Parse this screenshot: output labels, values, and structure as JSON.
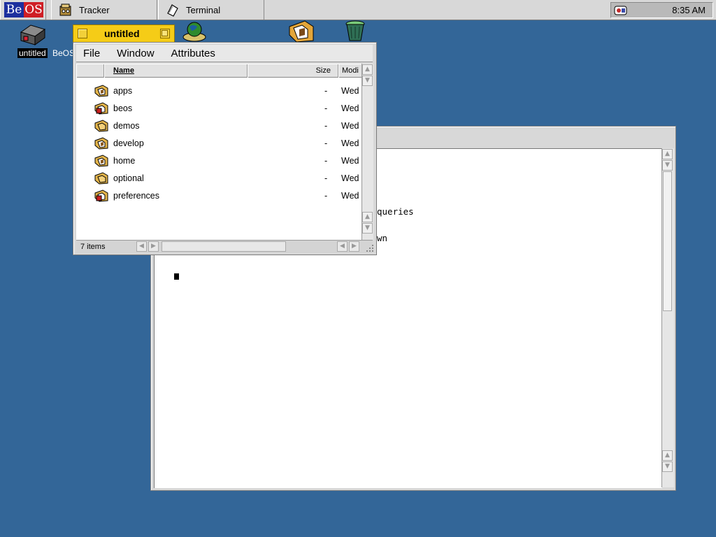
{
  "deskbar": {
    "logo_be": "Be",
    "logo_os": "OS",
    "tasks": [
      {
        "label": "Tracker",
        "icon": "tracker-icon"
      },
      {
        "label": "Terminal",
        "icon": "terminal-icon"
      }
    ],
    "clock": "8:35 AM"
  },
  "desktop": {
    "icons": [
      {
        "label": "untitled",
        "icon": "disk-icon",
        "selected": true
      },
      {
        "label": "BeOS",
        "icon": "beos-disk-icon"
      }
    ]
  },
  "tracker_window": {
    "title": "untitled",
    "menus": [
      "File",
      "Window",
      "Attributes"
    ],
    "columns": {
      "name": "Name",
      "size": "Size",
      "modified": "Modi"
    },
    "items": [
      {
        "name": "apps",
        "size": "-",
        "modified": "Wed",
        "icon": "query-folder-icon"
      },
      {
        "name": "beos",
        "size": "-",
        "modified": "Wed",
        "icon": "system-folder-icon"
      },
      {
        "name": "demos",
        "size": "-",
        "modified": "Wed",
        "icon": "folder-icon"
      },
      {
        "name": "develop",
        "size": "-",
        "modified": "Wed",
        "icon": "query-folder-icon"
      },
      {
        "name": "home",
        "size": "-",
        "modified": "Wed",
        "icon": "query-folder-icon"
      },
      {
        "name": "optional",
        "size": "-",
        "modified": "Wed",
        "icon": "folder-icon"
      },
      {
        "name": "preferences",
        "size": "-",
        "modified": "Wed",
        "icon": "system-folder-icon"
      }
    ],
    "item_count": "7 items"
  },
  "terminal_window": {
    "line1": "queries",
    "line2": "wn"
  },
  "colors": {
    "desktop": "#336698",
    "active_tab": "#f5cc17",
    "window_gray": "#d8d8d8"
  }
}
